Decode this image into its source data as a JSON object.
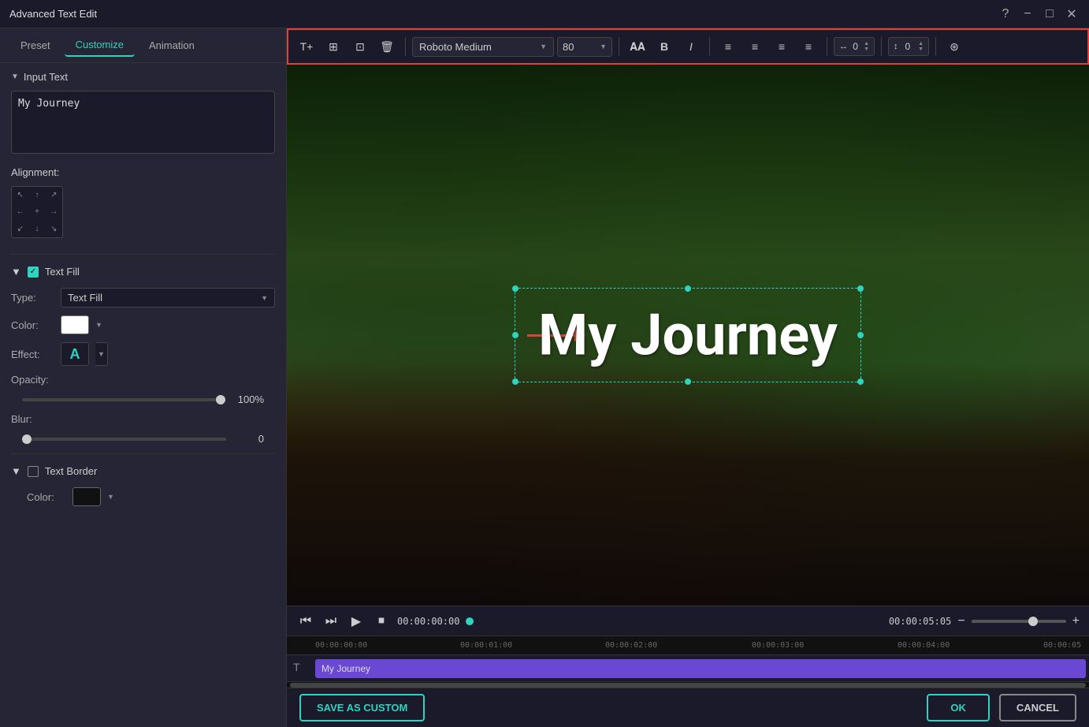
{
  "window": {
    "title": "Advanced Text Edit",
    "controls": {
      "help": "?",
      "minimize": "−",
      "maximize": "□",
      "close": "✕"
    }
  },
  "tabs": {
    "preset": "Preset",
    "customize": "Customize",
    "animation": "Animation"
  },
  "left_panel": {
    "input_text_section": "Input Text",
    "input_text_value": "My Journey",
    "alignment_label": "Alignment:",
    "text_fill_section": "Text Fill",
    "text_fill_type_label": "Type:",
    "text_fill_type_value": "Text Fill",
    "color_label": "Color:",
    "effect_label": "Effect:",
    "opacity_label": "Opacity:",
    "opacity_value": "100%",
    "blur_label": "Blur:",
    "blur_value": "0",
    "text_border_section": "Text Border",
    "border_color_label": "Color:"
  },
  "toolbar": {
    "font_name": "Roboto Medium",
    "font_size": "80",
    "bold": "B",
    "italic": "I",
    "char_spacing": "0",
    "line_spacing": "0"
  },
  "preview": {
    "text": "My Journey"
  },
  "timeline": {
    "current_time": "00:00:00:00",
    "total_time": "00:00:05:05",
    "clip_label": "My Journey",
    "ruler_marks": [
      "00:00:00:00",
      "00:00:01:00",
      "00:00:02:00",
      "00:00:03:00",
      "00:00:04:00",
      "00:00:05"
    ]
  },
  "footer": {
    "save_custom_label": "SAVE AS CUSTOM",
    "ok_label": "OK",
    "cancel_label": "CANCEL"
  }
}
